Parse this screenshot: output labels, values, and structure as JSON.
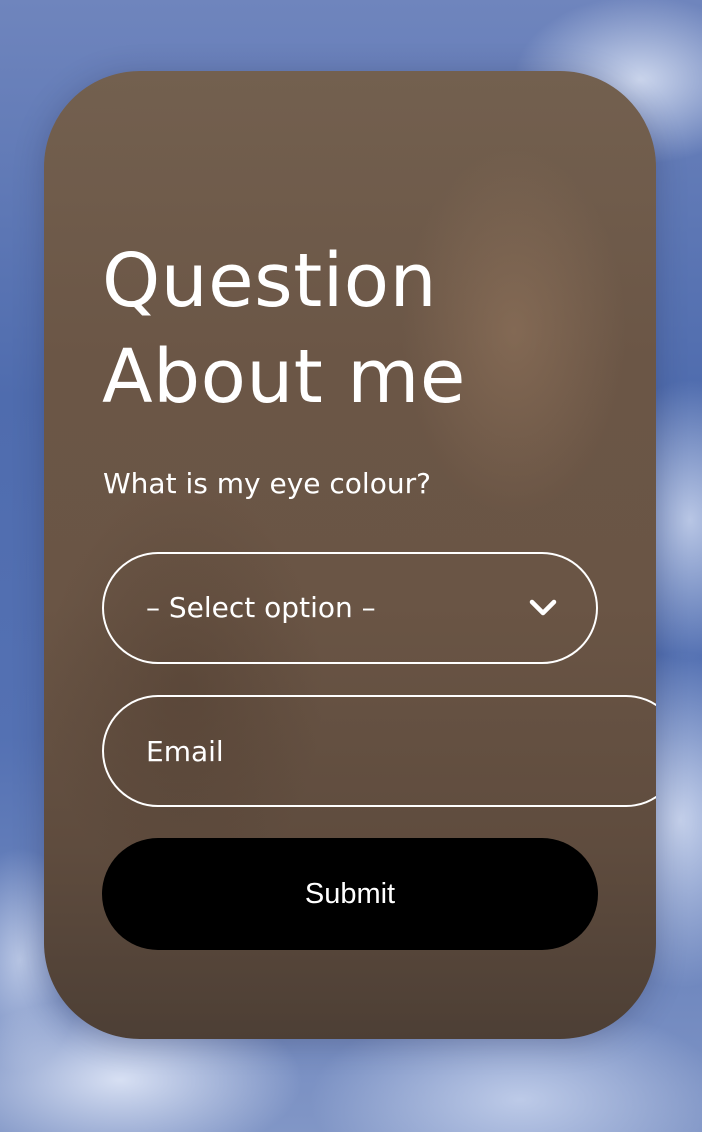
{
  "form": {
    "title_line1": "Question",
    "title_line2": "About me",
    "question": "What is my eye colour?",
    "select": {
      "selected": "– Select option –",
      "icon": "chevron-down-icon"
    },
    "email": {
      "placeholder": "Email",
      "value": ""
    },
    "submit_label": "Submit"
  },
  "colors": {
    "card": "#6b5646",
    "text": "#ffffff",
    "button": "#000000",
    "sky": "#5471b3"
  }
}
